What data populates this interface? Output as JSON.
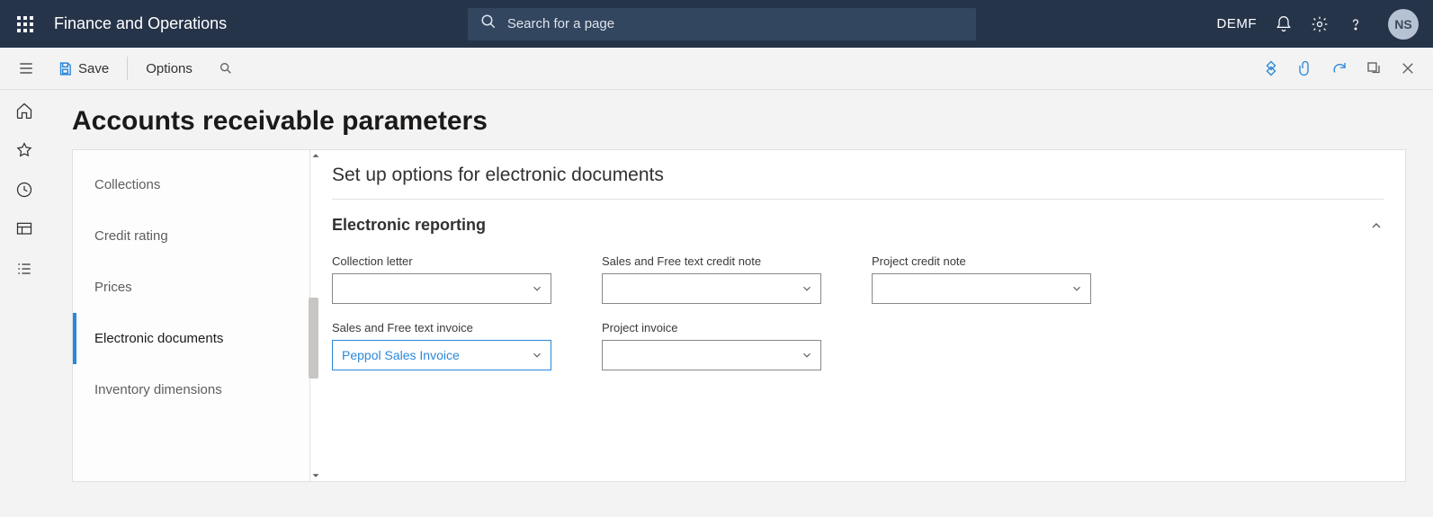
{
  "navbar": {
    "app_title": "Finance and Operations",
    "search_placeholder": "Search for a page",
    "company": "DEMF",
    "avatar": "NS"
  },
  "cmdbar": {
    "save_label": "Save",
    "options_label": "Options"
  },
  "page": {
    "title": "Accounts receivable parameters"
  },
  "tabs": {
    "collections": "Collections",
    "credit_rating": "Credit rating",
    "prices": "Prices",
    "electronic_documents": "Electronic documents",
    "inventory_dimensions": "Inventory dimensions"
  },
  "panel": {
    "heading": "Set up options for electronic documents",
    "section_title": "Electronic reporting",
    "fields": {
      "collection_letter": {
        "label": "Collection letter",
        "value": ""
      },
      "sales_credit_note": {
        "label": "Sales and Free text credit note",
        "value": ""
      },
      "project_credit_note": {
        "label": "Project credit note",
        "value": ""
      },
      "sales_invoice": {
        "label": "Sales and Free text invoice",
        "value": "Peppol Sales Invoice"
      },
      "project_invoice": {
        "label": "Project invoice",
        "value": ""
      }
    }
  }
}
